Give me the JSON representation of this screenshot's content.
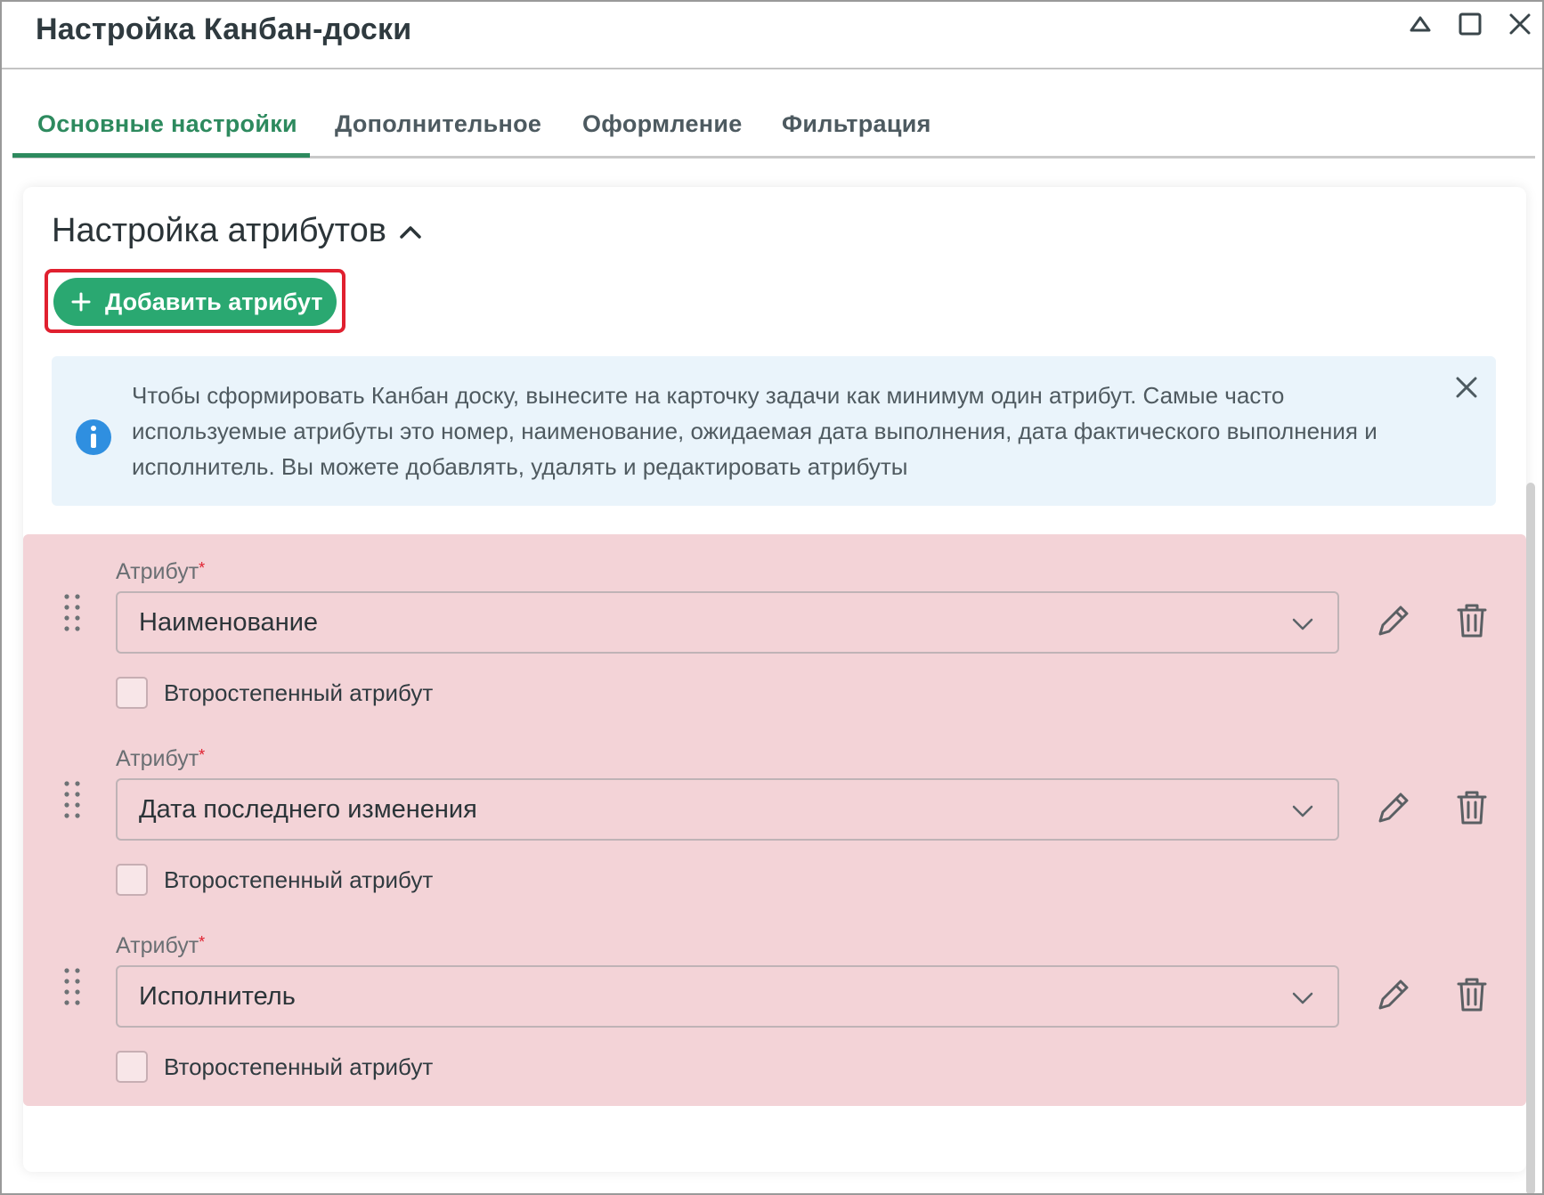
{
  "window": {
    "title": "Настройка Канбан-доски"
  },
  "tabs": [
    {
      "label": "Основные настройки",
      "active": true
    },
    {
      "label": "Дополнительное",
      "active": false
    },
    {
      "label": "Оформление",
      "active": false
    },
    {
      "label": "Фильтрация",
      "active": false
    }
  ],
  "section": {
    "title": "Настройка атрибутов",
    "add_button_label": "Добавить атрибут"
  },
  "info": {
    "text": "Чтобы сформировать Канбан доску, вынесите на карточку задачи как минимум один атрибут. Самые часто используемые атрибуты это номер, наименование, ожидаемая дата выполнения, дата фактического выполнения и исполнитель. Вы можете добавлять, удалять и редактировать атрибуты"
  },
  "attributes": [
    {
      "label": "Атрибут",
      "required_mark": "*",
      "value": "Наименование",
      "secondary_label": "Второстепенный атрибут",
      "secondary_checked": false
    },
    {
      "label": "Атрибут",
      "required_mark": "*",
      "value": "Дата последнего изменения",
      "secondary_label": "Второстепенный атрибут",
      "secondary_checked": false
    },
    {
      "label": "Атрибут",
      "required_mark": "*",
      "value": "Исполнитель",
      "secondary_label": "Второстепенный атрибут",
      "secondary_checked": false
    }
  ],
  "colors": {
    "accent_green": "#2d8a5e",
    "button_green": "#2aa871",
    "highlight_red": "#e0202f",
    "info_bg": "#eaf4fb",
    "info_icon_blue": "#2f8fe0",
    "attribute_row_bg": "#f3d3d7"
  },
  "icons": {
    "window_controls": [
      "collapse-icon",
      "maximize-icon",
      "close-icon"
    ],
    "section_toggle": "chevron-up-icon",
    "add": "plus-icon",
    "info": "info-icon",
    "info_close": "close-icon",
    "row": [
      "drag-handle-icon",
      "chevron-down-icon",
      "pencil-icon",
      "trash-icon"
    ]
  }
}
